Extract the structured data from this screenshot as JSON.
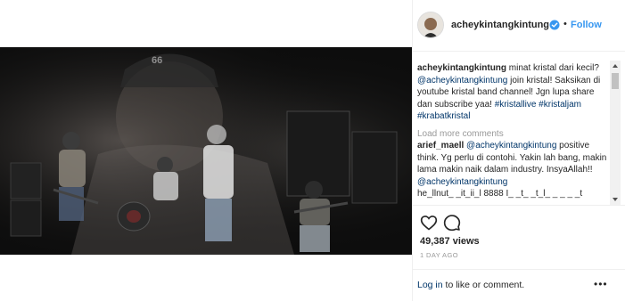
{
  "header": {
    "username": "acheykintangkintung",
    "dot": "•",
    "follow_label": "Follow"
  },
  "caption": {
    "user": "acheykintangkintung",
    "text_a": " minat kristal dari kecil? ",
    "mention": "@acheykintangkintung",
    "text_b": " join kristal! Saksikan di youtube kristal band channel! Jgn lupa share dan subscribe yaa! ",
    "hashtags": "#kristallive #kristaljam #krabatkristal"
  },
  "load_more_label": "Load more comments",
  "comment": {
    "user": "arief_maell",
    "mention": "@acheykintangkintung",
    "text": " positive think. Yg perlu di contohi. Yakin lah bang, makin lama makin naik dalam industry. InsyaAllah!!",
    "mention2": "@acheykintangkintung"
  },
  "partial_comment": "he_llnut_ _it_ii_l 8888 I_ _t_ _t_l_ _ _ _ _t",
  "stats": {
    "views": "49,387 views",
    "date": "1 DAY AGO"
  },
  "footer": {
    "login_link": "Log in",
    "login_text": " to like or comment.",
    "more_label": "•••"
  },
  "icons": {
    "verified": "verified-badge-icon",
    "heart": "heart-icon",
    "comment": "comment-icon",
    "more": "more-options-icon"
  },
  "colors": {
    "accent": "#3897f0",
    "link": "#003569",
    "muted": "#999999",
    "border": "#efefef",
    "video_bg": "#0d0d0d"
  }
}
